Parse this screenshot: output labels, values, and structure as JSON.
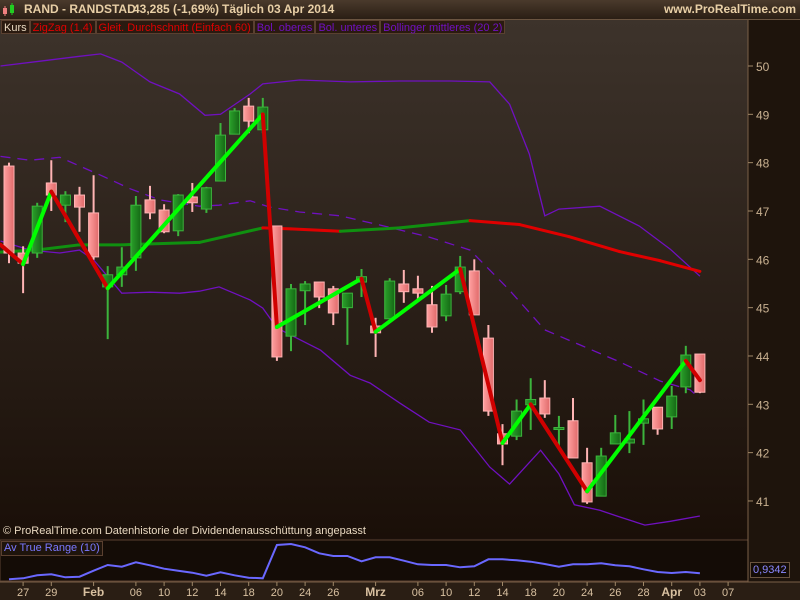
{
  "header": {
    "title": "RAND - RANDSTAD",
    "price": "43,285 (-1,69%)",
    "period": "Täglich  03 Apr 2014",
    "site": "www.ProRealTime.com"
  },
  "legend": [
    {
      "label": "Kurs",
      "color": "#e8d8c0"
    },
    {
      "label": "ZigZag (1,4)",
      "color": "#e00000"
    },
    {
      "label": "Gleit. Durchschnitt (Einfach 60)",
      "color": "#e00000"
    },
    {
      "label": "Bol. oberes",
      "color": "#7010c0"
    },
    {
      "label": "Bol. unteres",
      "color": "#7010c0"
    },
    {
      "label": "Bollinger mittleres (20 2)",
      "color": "#7010c0"
    }
  ],
  "copyright": "© ProRealTime.com  Datenhistorie der Dividendenausschüttung angepasst",
  "price_axis": [
    50,
    49,
    48,
    47,
    46,
    45,
    44,
    43,
    42,
    41
  ],
  "colors": {
    "bull": "#1f8a1f",
    "bull_border": "#3cb43c",
    "bear": "#f08a8a",
    "bear_border": "#ffb4b4",
    "zig_up": "#00ff00",
    "zig_down": "#d00000",
    "boll": "#7010c0",
    "atr": "#6a68ff"
  },
  "candles": [
    [
      47.93,
      46.13,
      48.0,
      45.92
    ],
    [
      46.13,
      45.92,
      46.27,
      45.3
    ],
    [
      46.13,
      47.1,
      47.17,
      46.03
    ],
    [
      47.58,
      47.33,
      48.05,
      47.0
    ],
    [
      47.12,
      47.33,
      47.41,
      46.77
    ],
    [
      47.33,
      47.08,
      47.5,
      46.57
    ],
    [
      46.96,
      46.05,
      47.74,
      45.99
    ],
    [
      45.43,
      45.68,
      45.86,
      44.35
    ],
    [
      45.68,
      45.84,
      46.25,
      45.43
    ],
    [
      46.03,
      47.12,
      47.31,
      45.76
    ],
    [
      47.23,
      46.96,
      47.52,
      46.83
    ],
    [
      47.02,
      46.57,
      47.14,
      46.54
    ],
    [
      46.59,
      47.33,
      47.35,
      46.48
    ],
    [
      47.29,
      47.17,
      47.58,
      46.98
    ],
    [
      47.04,
      47.48,
      47.5,
      46.96
    ],
    [
      47.62,
      48.57,
      48.82,
      47.62
    ],
    [
      48.59,
      49.07,
      49.13,
      48.59
    ],
    [
      49.17,
      48.86,
      49.34,
      48.61
    ],
    [
      48.68,
      49.15,
      49.34,
      48.61
    ],
    [
      46.69,
      43.98,
      46.69,
      43.9
    ],
    [
      44.41,
      45.39,
      45.49,
      44.1
    ],
    [
      45.35,
      45.49,
      45.55,
      44.64
    ],
    [
      45.53,
      45.22,
      45.53,
      44.99
    ],
    [
      45.39,
      44.89,
      45.45,
      44.64
    ],
    [
      45.0,
      45.3,
      45.3,
      44.23
    ],
    [
      45.53,
      45.64,
      45.8,
      45.22
    ],
    [
      44.62,
      44.48,
      44.79,
      43.98
    ],
    [
      44.77,
      45.55,
      45.61,
      44.77
    ],
    [
      45.49,
      45.33,
      45.78,
      45.1
    ],
    [
      45.39,
      45.3,
      45.66,
      45.12
    ],
    [
      45.06,
      44.6,
      45.45,
      44.48
    ],
    [
      44.83,
      45.28,
      45.47,
      44.72
    ],
    [
      45.33,
      45.84,
      46.07,
      45.28
    ],
    [
      45.76,
      44.85,
      46.0,
      44.85
    ],
    [
      44.37,
      42.86,
      44.64,
      42.76
    ],
    [
      42.39,
      42.18,
      42.59,
      41.74
    ],
    [
      42.34,
      42.86,
      43.1,
      42.26
    ],
    [
      42.99,
      43.1,
      43.54,
      42.47
    ],
    [
      43.13,
      42.8,
      43.5,
      42.72
    ],
    [
      42.5,
      42.52,
      42.76,
      42.1
    ],
    [
      42.66,
      41.89,
      43.13,
      41.89
    ],
    [
      41.79,
      40.98,
      42.1,
      40.94
    ],
    [
      41.1,
      41.93,
      42.1,
      41.1
    ],
    [
      42.18,
      42.41,
      42.78,
      42.18
    ],
    [
      42.2,
      42.28,
      42.86,
      41.99
    ],
    [
      42.61,
      42.7,
      43.1,
      42.16
    ],
    [
      42.94,
      42.49,
      42.94,
      42.37
    ],
    [
      42.74,
      43.17,
      43.38,
      42.49
    ],
    [
      43.36,
      44.02,
      44.21,
      43.23
    ],
    [
      44.04,
      43.25,
      44.04,
      43.23
    ]
  ],
  "zigzag": [
    [
      -0.6,
      46.3
    ],
    [
      1,
      45.9
    ],
    [
      3,
      47.4
    ],
    [
      7,
      45.4
    ],
    [
      18,
      49.0
    ],
    [
      19,
      44.6
    ],
    [
      25,
      45.6
    ],
    [
      26,
      44.5
    ],
    [
      32,
      45.8
    ],
    [
      35,
      42.2
    ],
    [
      37,
      43.0
    ],
    [
      41,
      41.2
    ],
    [
      48,
      43.9
    ],
    [
      49,
      43.5
    ]
  ],
  "ma60": [
    [
      -0.6,
      46.15
    ],
    [
      2.2,
      46.2
    ],
    [
      5,
      46.3
    ],
    [
      8,
      46.3
    ],
    [
      13.5,
      46.35
    ],
    [
      18,
      46.65
    ],
    [
      20,
      46.63
    ],
    [
      23.5,
      46.58
    ],
    [
      27.7,
      46.65
    ],
    [
      32.7,
      46.8
    ],
    [
      36.2,
      46.72
    ],
    [
      39.7,
      46.47
    ],
    [
      43.3,
      46.16
    ],
    [
      46.2,
      45.97
    ],
    [
      49,
      45.75
    ]
  ],
  "boll_upper": [
    [
      -0.6,
      50.0
    ],
    [
      2.2,
      50.1
    ],
    [
      5,
      50.2
    ],
    [
      6.5,
      50.25
    ],
    [
      8,
      50.08
    ],
    [
      10,
      49.67
    ],
    [
      12.1,
      49.42
    ],
    [
      13.9,
      48.98
    ],
    [
      15,
      49.0
    ],
    [
      17.1,
      49.42
    ],
    [
      18,
      49.63
    ],
    [
      20.6,
      49.71
    ],
    [
      24.2,
      49.67
    ],
    [
      27.7,
      49.69
    ],
    [
      31.3,
      49.69
    ],
    [
      34.1,
      49.67
    ],
    [
      35.5,
      49.21
    ],
    [
      36.9,
      48.18
    ],
    [
      38,
      46.9
    ],
    [
      39,
      47.04
    ],
    [
      41.9,
      47.1
    ],
    [
      44.7,
      46.69
    ],
    [
      46.9,
      46.21
    ],
    [
      49,
      45.65
    ]
  ],
  "boll_lower": [
    [
      -0.6,
      46.38
    ],
    [
      1.5,
      46.19
    ],
    [
      3.6,
      46.13
    ],
    [
      5,
      46.19
    ],
    [
      6,
      45.99
    ],
    [
      8,
      45.3
    ],
    [
      10,
      45.32
    ],
    [
      12.1,
      45.3
    ],
    [
      13.5,
      45.34
    ],
    [
      14.9,
      45.43
    ],
    [
      17.1,
      45.16
    ],
    [
      18,
      44.99
    ],
    [
      19,
      44.58
    ],
    [
      20,
      44.43
    ],
    [
      22.1,
      44.12
    ],
    [
      24.2,
      43.6
    ],
    [
      25.6,
      43.44
    ],
    [
      27.7,
      43.03
    ],
    [
      29.8,
      42.63
    ],
    [
      32,
      42.47
    ],
    [
      34.1,
      41.7
    ],
    [
      35.5,
      41.35
    ],
    [
      37.7,
      42.05
    ],
    [
      39,
      41.56
    ],
    [
      40.1,
      40.92
    ],
    [
      41.9,
      40.81
    ],
    [
      43.3,
      40.67
    ],
    [
      45.1,
      40.5
    ],
    [
      46.9,
      40.58
    ],
    [
      49,
      40.69
    ]
  ],
  "boll_mid": [
    [
      -0.6,
      48.13
    ],
    [
      1.5,
      48.05
    ],
    [
      3.6,
      48.11
    ],
    [
      6.5,
      47.74
    ],
    [
      8.6,
      47.46
    ],
    [
      10.7,
      47.23
    ],
    [
      13.5,
      47.1
    ],
    [
      14.9,
      47.12
    ],
    [
      17.1,
      47.21
    ],
    [
      18.5,
      47.08
    ],
    [
      20.6,
      46.98
    ],
    [
      23.5,
      46.9
    ],
    [
      26.3,
      46.71
    ],
    [
      29.8,
      46.46
    ],
    [
      32.7,
      46.19
    ],
    [
      35.5,
      45.36
    ],
    [
      38,
      44.54
    ],
    [
      40.5,
      44.23
    ],
    [
      43.3,
      43.88
    ],
    [
      46.2,
      43.48
    ],
    [
      48.3,
      43.3
    ],
    [
      49,
      43.13
    ]
  ],
  "atr": {
    "label": "Av True Range (10)",
    "value_label": "0,9342",
    "values": [
      0.862,
      0.874,
      0.91,
      0.922,
      0.886,
      0.893,
      0.965,
      1.034,
      1.013,
      1.066,
      1.03,
      0.989,
      0.965,
      0.941,
      0.905,
      0.946,
      0.91,
      0.881,
      0.874,
      1.274,
      1.286,
      1.246,
      1.174,
      1.142,
      1.142,
      1.078,
      1.126,
      1.126,
      1.085,
      1.042,
      1.034,
      1.034,
      1.006,
      1.018,
      1.102,
      1.102,
      1.09,
      1.073,
      1.046,
      1.013,
      1.042,
      1.042,
      1.054,
      1.03,
      1.018,
      0.982,
      0.95,
      0.938,
      0.95,
      0.934
    ]
  },
  "date_axis": [
    {
      "label": "27",
      "i": 1
    },
    {
      "label": "29",
      "i": 3
    },
    {
      "label": "Feb",
      "i": 6,
      "bold": true
    },
    {
      "label": "06",
      "i": 9
    },
    {
      "label": "10",
      "i": 11
    },
    {
      "label": "12",
      "i": 13
    },
    {
      "label": "14",
      "i": 15
    },
    {
      "label": "18",
      "i": 17
    },
    {
      "label": "20",
      "i": 19
    },
    {
      "label": "24",
      "i": 21
    },
    {
      "label": "26",
      "i": 23
    },
    {
      "label": "Mrz",
      "i": 26,
      "bold": true
    },
    {
      "label": "06",
      "i": 29
    },
    {
      "label": "10",
      "i": 31
    },
    {
      "label": "12",
      "i": 33
    },
    {
      "label": "14",
      "i": 35
    },
    {
      "label": "18",
      "i": 37
    },
    {
      "label": "20",
      "i": 39
    },
    {
      "label": "24",
      "i": 41
    },
    {
      "label": "26",
      "i": 43
    },
    {
      "label": "28",
      "i": 45
    },
    {
      "label": "Apr",
      "i": 47,
      "bold": true
    },
    {
      "label": "03",
      "i": 49
    },
    {
      "label": "07",
      "i": 51
    }
  ]
}
